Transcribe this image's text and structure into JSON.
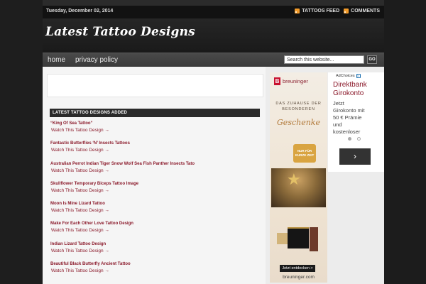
{
  "topbar": {
    "date": "Tuesday, December 02, 2014",
    "feeds": [
      {
        "label": "TATTOOS FEED",
        "icon": "rss-icon"
      },
      {
        "label": "COMMENTS",
        "icon": "rss-icon"
      }
    ]
  },
  "header": {
    "site_title": "Latest Tattoo Designs"
  },
  "nav": {
    "items": [
      {
        "label": "home"
      },
      {
        "label": "privacy policy"
      }
    ],
    "search_value": "Search this website...",
    "go_label": "GO"
  },
  "main": {
    "section_title": "LATEST TATTOO DESIGNS ADDED",
    "posts": [
      {
        "title": "“King Of Sea Tattoo”",
        "link": "Watch This Tattoo Design →"
      },
      {
        "title": "Fantastic Butterflies ‘N’ Insects Tattoos",
        "link": "Watch This Tattoo Design →"
      },
      {
        "title": "Australian Perrot Indian Tiger Snow Wolf Sea Fish Panther Insects Tato",
        "link": "Watch This Tattoo Design →"
      },
      {
        "title": "Skullflower Temporary Biceps Tattoo Image",
        "link": "Watch This Tattoo Design →"
      },
      {
        "title": "Moon Is Mine Lizard Tattoo",
        "link": "Watch This Tattoo Design →"
      },
      {
        "title": "Make For Each Other Love Tattoo Design",
        "link": "Watch This Tattoo Design →"
      },
      {
        "title": "Indian Lizard Tattoo Design",
        "link": "Watch This Tattoo Design →"
      },
      {
        "title": "Beautiful Black Butterfly Ancient Tattoo",
        "link": "Watch This Tattoo Design →"
      }
    ]
  },
  "sidebar": {
    "ad1": {
      "brand": "breuninger",
      "brand_mark": "B",
      "headline_1": "DAS ZUHAUSE DER",
      "headline_2": "BESONDEREN",
      "script": "Geschenke",
      "badge_1": "NUR FÜR",
      "badge_2": "KURZE ZEIT",
      "cta": "Jetzt entdecken >",
      "url": "breuninger.com"
    },
    "ad2": {
      "adchoices": "AdChoices",
      "title_1": "Direktbank",
      "title_2": "Girokonto",
      "text_1": "Jetzt",
      "text_2": "Girokonto mit",
      "text_3": "50 € Prämie",
      "text_4": "und",
      "text_5": "kostenloser",
      "arrow": "›"
    }
  },
  "colors": {
    "accent": "#8b1a2b",
    "page_bg": "#1e1e1e",
    "content_bg": "#f5f5f5",
    "rss": "#f19a2a"
  }
}
